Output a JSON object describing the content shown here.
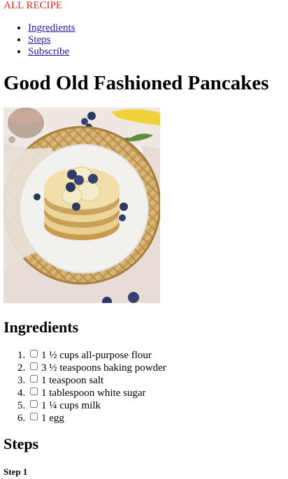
{
  "header": {
    "brand": "ALL RECIPE",
    "nav": [
      "Ingredients",
      "Steps",
      "Subscribe"
    ]
  },
  "recipe": {
    "title": "Good Old Fashioned Pancakes",
    "ingredients_heading": "Ingredients",
    "ingredients": [
      "1 ½ cups all-purpose flour",
      "3 ½ teaspoons baking powder",
      "1 teaspoon salt",
      "1 tablespoon white sugar",
      "1 ¼ cups milk",
      "1 egg"
    ],
    "steps_heading": "Steps",
    "first_step_label": "Step 1"
  },
  "colors": {
    "brand": "#e0271b",
    "link": "#2617a6"
  },
  "icons": [
    "checkbox"
  ]
}
